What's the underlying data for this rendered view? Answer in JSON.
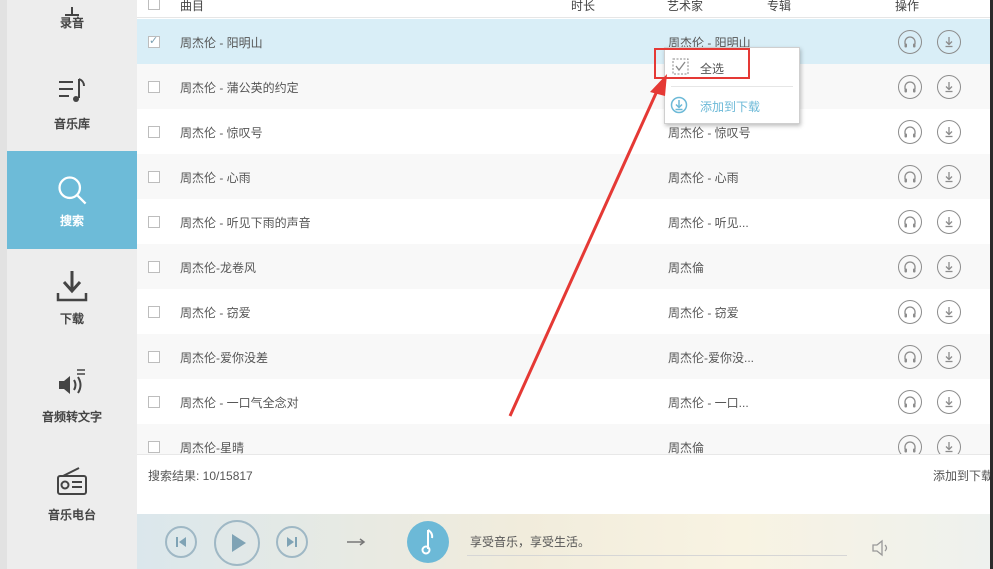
{
  "sidebar": {
    "items": [
      {
        "label": "录音",
        "icon": "microphone-icon",
        "active": false
      },
      {
        "label": "音乐库",
        "icon": "music-library-icon",
        "active": false
      },
      {
        "label": "搜索",
        "icon": "search-icon",
        "active": true
      },
      {
        "label": "下载",
        "icon": "download-icon",
        "active": false
      },
      {
        "label": "音频转文字",
        "icon": "audio-to-text-icon",
        "active": false
      },
      {
        "label": "音乐电台",
        "icon": "radio-icon",
        "active": false
      }
    ]
  },
  "table": {
    "columns": {
      "title": "曲目",
      "duration": "时长",
      "artist": "艺术家",
      "album": "专辑",
      "actions": "操作"
    },
    "rows": [
      {
        "title": "周杰伦 - 阳明山",
        "artist": "周杰伦 - 阳明山",
        "checked": true,
        "selected": true
      },
      {
        "title": "周杰伦 - 蒲公英的约定",
        "artist": "",
        "checked": false,
        "selected": false
      },
      {
        "title": "周杰伦 - 惊叹号",
        "artist": "周杰伦 - 惊叹号",
        "checked": false,
        "selected": false
      },
      {
        "title": "周杰伦 - 心雨",
        "artist": "周杰伦 - 心雨",
        "checked": false,
        "selected": false
      },
      {
        "title": "周杰伦 - 听见下雨的声音",
        "artist": "周杰伦 - 听见...",
        "checked": false,
        "selected": false
      },
      {
        "title": "周杰伦-龙卷风",
        "artist": "周杰倫",
        "checked": false,
        "selected": false
      },
      {
        "title": "周杰伦 - 窃爱",
        "artist": "周杰伦 - 窃爱",
        "checked": false,
        "selected": false
      },
      {
        "title": "周杰伦-爱你没差",
        "artist": "周杰伦-爱你没...",
        "checked": false,
        "selected": false
      },
      {
        "title": "周杰伦 - 一口气全念对",
        "artist": "周杰伦 - 一口...",
        "checked": false,
        "selected": false
      },
      {
        "title": "周杰伦-星晴",
        "artist": "周杰倫",
        "checked": false,
        "selected": false
      }
    ]
  },
  "context_menu": {
    "select_all": "全选",
    "add_to_download": "添加到下载"
  },
  "footer": {
    "result_text": "搜索结果: 10/15817",
    "add_to_download": "添加到下载"
  },
  "player": {
    "tagline": "享受音乐，享受生活。"
  },
  "colors": {
    "accent": "#6dbbd8",
    "annotation": "#e53935"
  }
}
